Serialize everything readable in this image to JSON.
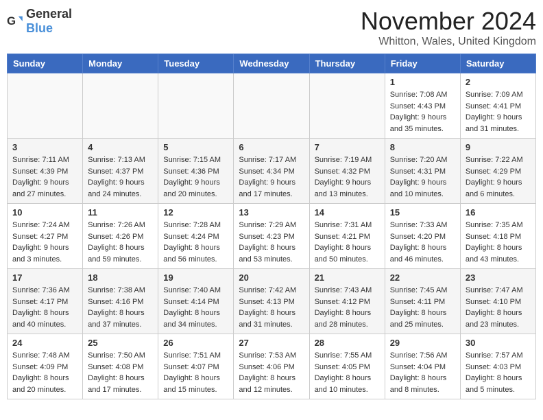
{
  "header": {
    "logo_general": "General",
    "logo_blue": "Blue",
    "month_title": "November 2024",
    "location": "Whitton, Wales, United Kingdom"
  },
  "weekdays": [
    "Sunday",
    "Monday",
    "Tuesday",
    "Wednesday",
    "Thursday",
    "Friday",
    "Saturday"
  ],
  "weeks": [
    [
      {
        "day": "",
        "info": ""
      },
      {
        "day": "",
        "info": ""
      },
      {
        "day": "",
        "info": ""
      },
      {
        "day": "",
        "info": ""
      },
      {
        "day": "",
        "info": ""
      },
      {
        "day": "1",
        "info": "Sunrise: 7:08 AM\nSunset: 4:43 PM\nDaylight: 9 hours and 35 minutes."
      },
      {
        "day": "2",
        "info": "Sunrise: 7:09 AM\nSunset: 4:41 PM\nDaylight: 9 hours and 31 minutes."
      }
    ],
    [
      {
        "day": "3",
        "info": "Sunrise: 7:11 AM\nSunset: 4:39 PM\nDaylight: 9 hours and 27 minutes."
      },
      {
        "day": "4",
        "info": "Sunrise: 7:13 AM\nSunset: 4:37 PM\nDaylight: 9 hours and 24 minutes."
      },
      {
        "day": "5",
        "info": "Sunrise: 7:15 AM\nSunset: 4:36 PM\nDaylight: 9 hours and 20 minutes."
      },
      {
        "day": "6",
        "info": "Sunrise: 7:17 AM\nSunset: 4:34 PM\nDaylight: 9 hours and 17 minutes."
      },
      {
        "day": "7",
        "info": "Sunrise: 7:19 AM\nSunset: 4:32 PM\nDaylight: 9 hours and 13 minutes."
      },
      {
        "day": "8",
        "info": "Sunrise: 7:20 AM\nSunset: 4:31 PM\nDaylight: 9 hours and 10 minutes."
      },
      {
        "day": "9",
        "info": "Sunrise: 7:22 AM\nSunset: 4:29 PM\nDaylight: 9 hours and 6 minutes."
      }
    ],
    [
      {
        "day": "10",
        "info": "Sunrise: 7:24 AM\nSunset: 4:27 PM\nDaylight: 9 hours and 3 minutes."
      },
      {
        "day": "11",
        "info": "Sunrise: 7:26 AM\nSunset: 4:26 PM\nDaylight: 8 hours and 59 minutes."
      },
      {
        "day": "12",
        "info": "Sunrise: 7:28 AM\nSunset: 4:24 PM\nDaylight: 8 hours and 56 minutes."
      },
      {
        "day": "13",
        "info": "Sunrise: 7:29 AM\nSunset: 4:23 PM\nDaylight: 8 hours and 53 minutes."
      },
      {
        "day": "14",
        "info": "Sunrise: 7:31 AM\nSunset: 4:21 PM\nDaylight: 8 hours and 50 minutes."
      },
      {
        "day": "15",
        "info": "Sunrise: 7:33 AM\nSunset: 4:20 PM\nDaylight: 8 hours and 46 minutes."
      },
      {
        "day": "16",
        "info": "Sunrise: 7:35 AM\nSunset: 4:18 PM\nDaylight: 8 hours and 43 minutes."
      }
    ],
    [
      {
        "day": "17",
        "info": "Sunrise: 7:36 AM\nSunset: 4:17 PM\nDaylight: 8 hours and 40 minutes."
      },
      {
        "day": "18",
        "info": "Sunrise: 7:38 AM\nSunset: 4:16 PM\nDaylight: 8 hours and 37 minutes."
      },
      {
        "day": "19",
        "info": "Sunrise: 7:40 AM\nSunset: 4:14 PM\nDaylight: 8 hours and 34 minutes."
      },
      {
        "day": "20",
        "info": "Sunrise: 7:42 AM\nSunset: 4:13 PM\nDaylight: 8 hours and 31 minutes."
      },
      {
        "day": "21",
        "info": "Sunrise: 7:43 AM\nSunset: 4:12 PM\nDaylight: 8 hours and 28 minutes."
      },
      {
        "day": "22",
        "info": "Sunrise: 7:45 AM\nSunset: 4:11 PM\nDaylight: 8 hours and 25 minutes."
      },
      {
        "day": "23",
        "info": "Sunrise: 7:47 AM\nSunset: 4:10 PM\nDaylight: 8 hours and 23 minutes."
      }
    ],
    [
      {
        "day": "24",
        "info": "Sunrise: 7:48 AM\nSunset: 4:09 PM\nDaylight: 8 hours and 20 minutes."
      },
      {
        "day": "25",
        "info": "Sunrise: 7:50 AM\nSunset: 4:08 PM\nDaylight: 8 hours and 17 minutes."
      },
      {
        "day": "26",
        "info": "Sunrise: 7:51 AM\nSunset: 4:07 PM\nDaylight: 8 hours and 15 minutes."
      },
      {
        "day": "27",
        "info": "Sunrise: 7:53 AM\nSunset: 4:06 PM\nDaylight: 8 hours and 12 minutes."
      },
      {
        "day": "28",
        "info": "Sunrise: 7:55 AM\nSunset: 4:05 PM\nDaylight: 8 hours and 10 minutes."
      },
      {
        "day": "29",
        "info": "Sunrise: 7:56 AM\nSunset: 4:04 PM\nDaylight: 8 hours and 8 minutes."
      },
      {
        "day": "30",
        "info": "Sunrise: 7:57 AM\nSunset: 4:03 PM\nDaylight: 8 hours and 5 minutes."
      }
    ]
  ]
}
